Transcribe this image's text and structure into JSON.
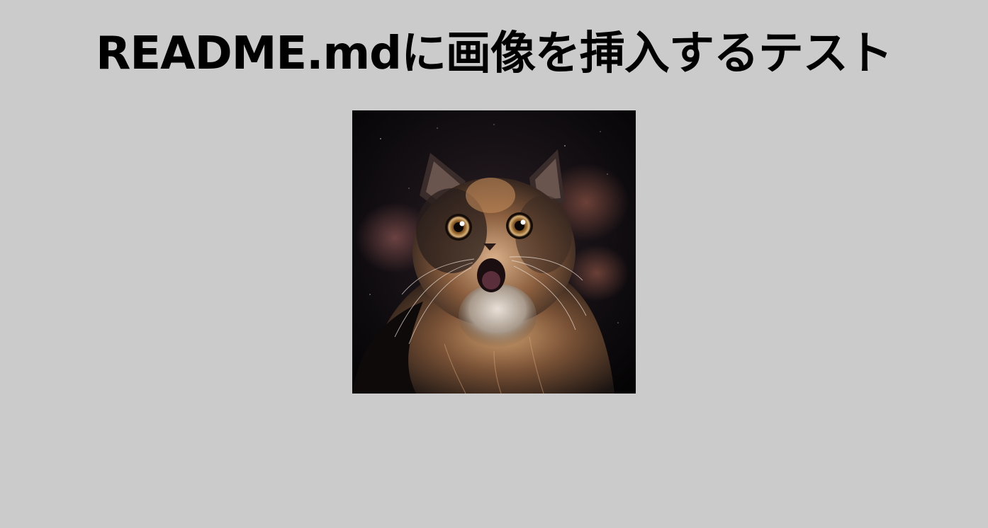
{
  "page": {
    "title": "README.mdに画像を挿入するテスト",
    "background_color": "#cbcbcb",
    "title_color": "#000000"
  },
  "image": {
    "alt": "cat",
    "icon": "cat-photo"
  }
}
